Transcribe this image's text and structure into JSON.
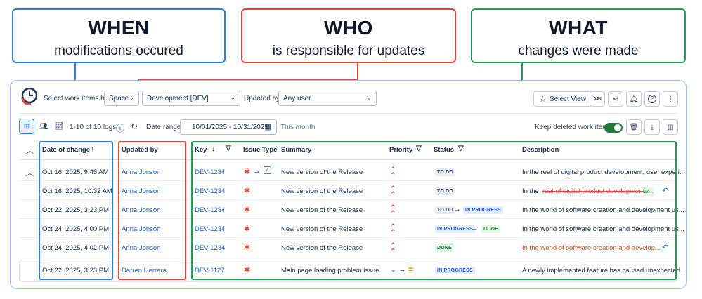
{
  "callouts": {
    "when": {
      "title": "WHEN",
      "text": "modifications occured"
    },
    "who": {
      "title": "WHO",
      "text": "is responsible for updates"
    },
    "what": {
      "title": "WHAT",
      "text": "changes were made"
    }
  },
  "toolbar": {
    "select_label": "Select work items by:",
    "space_select": "Space",
    "project_select": "Development [DEV]",
    "updated_by_label": "Updated by:",
    "updated_by_select": "Any user",
    "select_view_label": "Select View",
    "api_label": "API",
    "logs_count": "1-10 of 10 logs",
    "date_range_label": "Date range:",
    "date_range_value": "10/01/2025 - 10/31/2025",
    "date_hint": "This month",
    "keep_deleted_label": "Keep deleted work items",
    "keep_deleted_on": true
  },
  "table": {
    "headers": {
      "date": "Date of change",
      "updated_by": "Updated by",
      "key": "Key",
      "issue_type": "Issue Type",
      "summary": "Summary",
      "priority": "Priority",
      "status": "Status",
      "description": "Description"
    },
    "rows": [
      {
        "date": "Oct 16, 2025, 9:45 AM",
        "user": "Anna Jonson",
        "key": "DEV-1234",
        "summary": "New version of the Release",
        "status_from": "TO DO",
        "status_to": "",
        "description": "In the real of digital product development, user experi..."
      },
      {
        "date": "Oct 16, 2025, 10:32 AM",
        "user": "Anna Jonson",
        "key": "DEV-1234",
        "summary": "New version of the Release",
        "status_from": "TO DO",
        "status_to": "",
        "description_prefix": "In the",
        "description_struck": "real of digital product development",
        "description_suffix": "w..."
      },
      {
        "date": "Oct 22, 2025, 3:23 PM",
        "user": "Anna Jonson",
        "key": "DEV-1234",
        "summary": "New version of the Release",
        "status_from": "TO DO",
        "status_to": "IN PROGRESS",
        "description": "In the world of software creation and development us..."
      },
      {
        "date": "Oct 24, 2025, 4:00 PM",
        "user": "Anna Jonson",
        "key": "DEV-1234",
        "summary": "New version of the Release",
        "status_from": "IN PROGRESS",
        "status_to": "DONE",
        "description": "In the world of software creation and development us..."
      },
      {
        "date": "Oct 24, 2025, 4:02 PM",
        "user": "Anna Jonson",
        "key": "DEV-1234",
        "summary": "New version of the Release",
        "status_from": "DONE",
        "status_to": "",
        "description_struck": "In the world of software creation and develop..."
      },
      {
        "date": "Oct 22, 2025, 3:23 PM",
        "user": "Darren Herrera",
        "key": "DEV-1127",
        "summary": "Main page loading problem issue",
        "status_from": "IN PROGRESS",
        "status_to": "",
        "description": "A newly implemented feature has caused unexpected..."
      }
    ]
  },
  "colors": {
    "when": "#2f7be0",
    "who": "#e0483f",
    "what": "#22a052",
    "link": "#1f5fd1"
  }
}
